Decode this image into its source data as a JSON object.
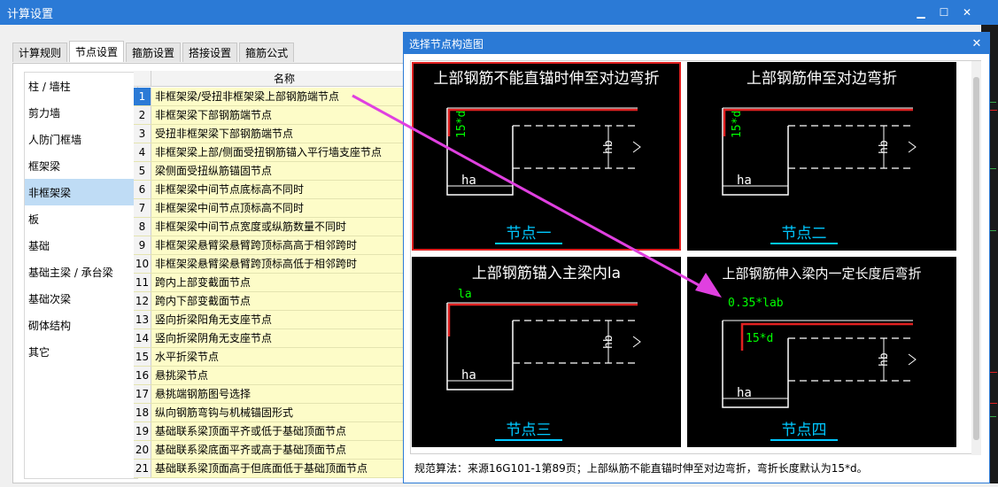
{
  "window": {
    "title": "计算设置",
    "min": "▁",
    "max": "☐",
    "close": "✕"
  },
  "tabs": [
    "计算规则",
    "节点设置",
    "箍筋设置",
    "搭接设置",
    "箍筋公式"
  ],
  "active_tab": 1,
  "nav": [
    "柱 / 墙柱",
    "剪力墙",
    "人防门框墙",
    "框架梁",
    "非框架梁",
    "板",
    "基础",
    "基础主梁 / 承台梁",
    "基础次梁",
    "砌体结构",
    "其它"
  ],
  "nav_selected": 4,
  "grid": {
    "header": "名称",
    "rows": [
      {
        "n": "1",
        "name": "非框架梁/受扭非框架梁上部钢筋端节点"
      },
      {
        "n": "2",
        "name": "非框架梁下部钢筋端节点"
      },
      {
        "n": "3",
        "name": "受扭非框架梁下部钢筋端节点"
      },
      {
        "n": "4",
        "name": "非框架梁上部/侧面受扭钢筋锚入平行墙支座节点"
      },
      {
        "n": "5",
        "name": "梁侧面受扭纵筋锚固节点"
      },
      {
        "n": "6",
        "name": "非框架梁中间节点底标高不同时"
      },
      {
        "n": "7",
        "name": "非框架梁中间节点顶标高不同时"
      },
      {
        "n": "8",
        "name": "非框架梁中间节点宽度或纵筋数量不同时"
      },
      {
        "n": "9",
        "name": "非框架梁悬臂梁悬臂跨顶标高高于相邻跨时"
      },
      {
        "n": "10",
        "name": "非框架梁悬臂梁悬臂跨顶标高低于相邻跨时"
      },
      {
        "n": "11",
        "name": "跨内上部变截面节点"
      },
      {
        "n": "12",
        "name": "跨内下部变截面节点"
      },
      {
        "n": "13",
        "name": "竖向折梁阳角无支座节点"
      },
      {
        "n": "14",
        "name": "竖向折梁阴角无支座节点"
      },
      {
        "n": "15",
        "name": "水平折梁节点"
      },
      {
        "n": "16",
        "name": "悬挑梁节点"
      },
      {
        "n": "17",
        "name": "悬挑端钢筋图号选择"
      },
      {
        "n": "18",
        "name": "纵向钢筋弯钩与机械锚固形式"
      },
      {
        "n": "19",
        "name": "基础联系梁顶面平齐或低于基础顶面节点"
      },
      {
        "n": "20",
        "name": "基础联系梁底面平齐或高于基础顶面节点"
      },
      {
        "n": "21",
        "name": "基础联系梁顶面高于但底面低于基础顶面节点"
      }
    ],
    "selected_row": 0
  },
  "dialog": {
    "title": "选择节点构造图",
    "close": "✕",
    "nodes": [
      {
        "title": "上部钢筋不能直锚时伸至对边弯折",
        "caption": "节点一",
        "label": "15*d",
        "ha": "ha",
        "hb": "hb"
      },
      {
        "title": "上部钢筋伸至对边弯折",
        "caption": "节点二",
        "label": "15*d",
        "ha": "ha",
        "hb": "hb"
      },
      {
        "title": "上部钢筋锚入主梁内la",
        "caption": "节点三",
        "label": "la",
        "ha": "ha",
        "hb": "hb"
      },
      {
        "title": "上部钢筋伸入梁内一定长度后弯折",
        "caption": "节点四",
        "label": "0.35*lab",
        "label2": "15*d",
        "ha": "ha",
        "hb": "hb"
      }
    ],
    "selected_node": 0,
    "footer": "规范算法：来源16G101-1第89页；上部纵筋不能直锚时伸至对边弯折，弯折长度默认为15*d。"
  },
  "colors": {
    "accent": "#2b7ad6",
    "rebar": "#e02020",
    "dim": "#00ff00",
    "caption": "#00c8ff",
    "arrow": "#e040e0"
  }
}
